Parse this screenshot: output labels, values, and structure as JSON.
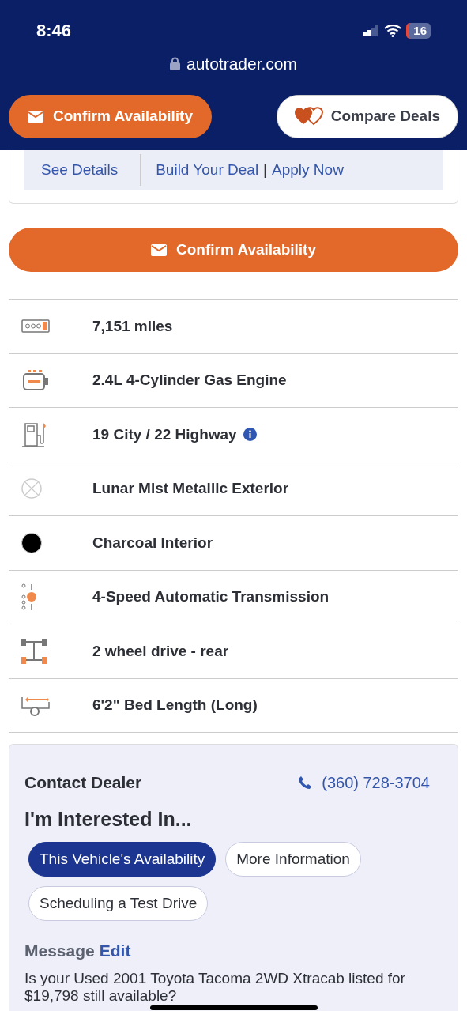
{
  "status_bar": {
    "time": "8:46",
    "battery": "16"
  },
  "address_bar": {
    "url": "autotrader.com"
  },
  "sticky_actions": [
    {
      "kind": "primary",
      "label": "Confirm Availability"
    },
    {
      "kind": "secondary",
      "label": "Compare Deals"
    }
  ],
  "deal_links": [
    {
      "label": "See Details"
    },
    {
      "label": "Build Your Deal"
    },
    {
      "label": "Apply Now"
    }
  ],
  "deal_links_separator": "|",
  "confirm_button": {
    "label": "Confirm Availability"
  },
  "specs": [
    {
      "kind": "odometer",
      "text": "7,151 miles"
    },
    {
      "kind": "engine",
      "text": "2.4L 4-Cylinder Gas Engine"
    },
    {
      "kind": "fuel",
      "text": "19 City / 22 Highway",
      "info": true
    },
    {
      "kind": "exterior",
      "text": "Lunar Mist Metallic Exterior"
    },
    {
      "kind": "interior",
      "text": "Charcoal Interior",
      "color": "#000000"
    },
    {
      "kind": "transmission",
      "text": "4-Speed Automatic Transmission"
    },
    {
      "kind": "drivetrain",
      "text": "2 wheel drive - rear"
    },
    {
      "kind": "bed",
      "text": "6'2\" Bed Length (Long)"
    }
  ],
  "contact": {
    "title": "Contact Dealer",
    "phone": "(360) 728-3704",
    "interest_title": "I'm Interested In...",
    "options": [
      {
        "label": "This Vehicle's Availability",
        "selected": true
      },
      {
        "label": "More Information",
        "selected": false
      },
      {
        "label": "Scheduling a Test Drive",
        "selected": false
      }
    ],
    "message_label": "Message",
    "edit_link": "Edit",
    "message": "Is your Used 2001 Toyota Tacoma 2WD Xtracab listed for $19,798 still available?"
  }
}
